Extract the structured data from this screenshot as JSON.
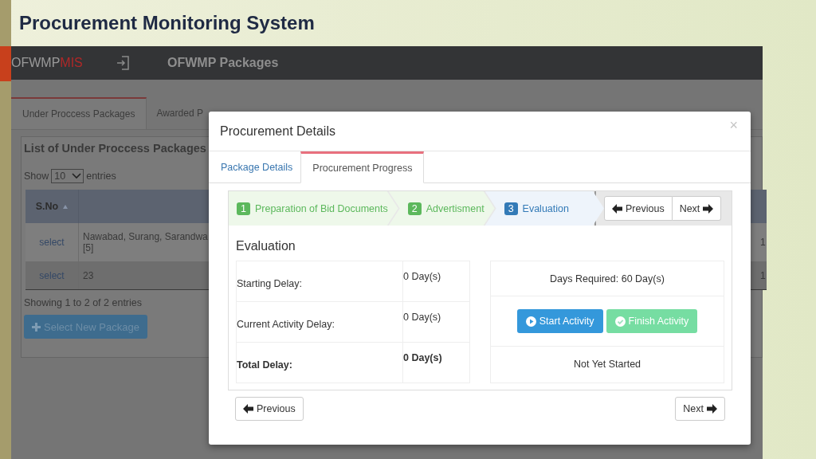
{
  "slide": {
    "title": "Procurement Monitoring System"
  },
  "navbar": {
    "brand": "OFWMP",
    "brand_suffix": "MIS",
    "page_title": "OFWMP Packages"
  },
  "tabs": [
    {
      "label": "Under Proccess Packages",
      "selected": true
    },
    {
      "label": "Awarded P",
      "selected": false
    }
  ],
  "panel": {
    "title": "List of Under Proccess Packages",
    "show_label": "Show",
    "page_size": "10",
    "entries_label": "entries",
    "table": {
      "columns": [
        "S.No"
      ],
      "rows": [
        {
          "link": "select",
          "column_2": [
            "Nawabad, Surang, Sarandwa",
            "[5]"
          ],
          "column_3": "1"
        },
        {
          "link": "select",
          "column_2": [
            "23"
          ],
          "column_3": "1"
        }
      ]
    },
    "info": "Showing 1 to 2 of 2 entries",
    "button": "Select New Package"
  },
  "modal": {
    "title": "Procurement Details",
    "close": "×",
    "tabs": [
      {
        "label": "Package Details",
        "selected": false
      },
      {
        "label": "Procurement Progress",
        "selected": true
      }
    ],
    "steps": [
      {
        "number": "1",
        "label": "Preparation of Bid Documents",
        "selected": false
      },
      {
        "number": "2",
        "label": "Advertisment",
        "selected": false
      },
      {
        "number": "3",
        "label": "Evaluation",
        "selected": true
      }
    ],
    "wizard_buttons": [
      "Previous",
      "Next"
    ],
    "section_title": "Evaluation",
    "delays": [
      {
        "label": "Starting Delay:",
        "value": "0 Day(s)",
        "bold": false
      },
      {
        "label": "Current Activity Delay:",
        "value": "0 Day(s)",
        "bold": false
      },
      {
        "label": "Total Delay:",
        "value": "0 Day(s)",
        "bold": true
      }
    ],
    "days_required": "Days Required: 60 Day(s)",
    "actions": [
      {
        "label": "Start Activity",
        "kind": "start",
        "disabled": false
      },
      {
        "label": "Finish Activity",
        "kind": "finish",
        "disabled": true
      }
    ],
    "status": "Not Yet Started",
    "footer_buttons": [
      "Previous",
      "Next"
    ]
  }
}
